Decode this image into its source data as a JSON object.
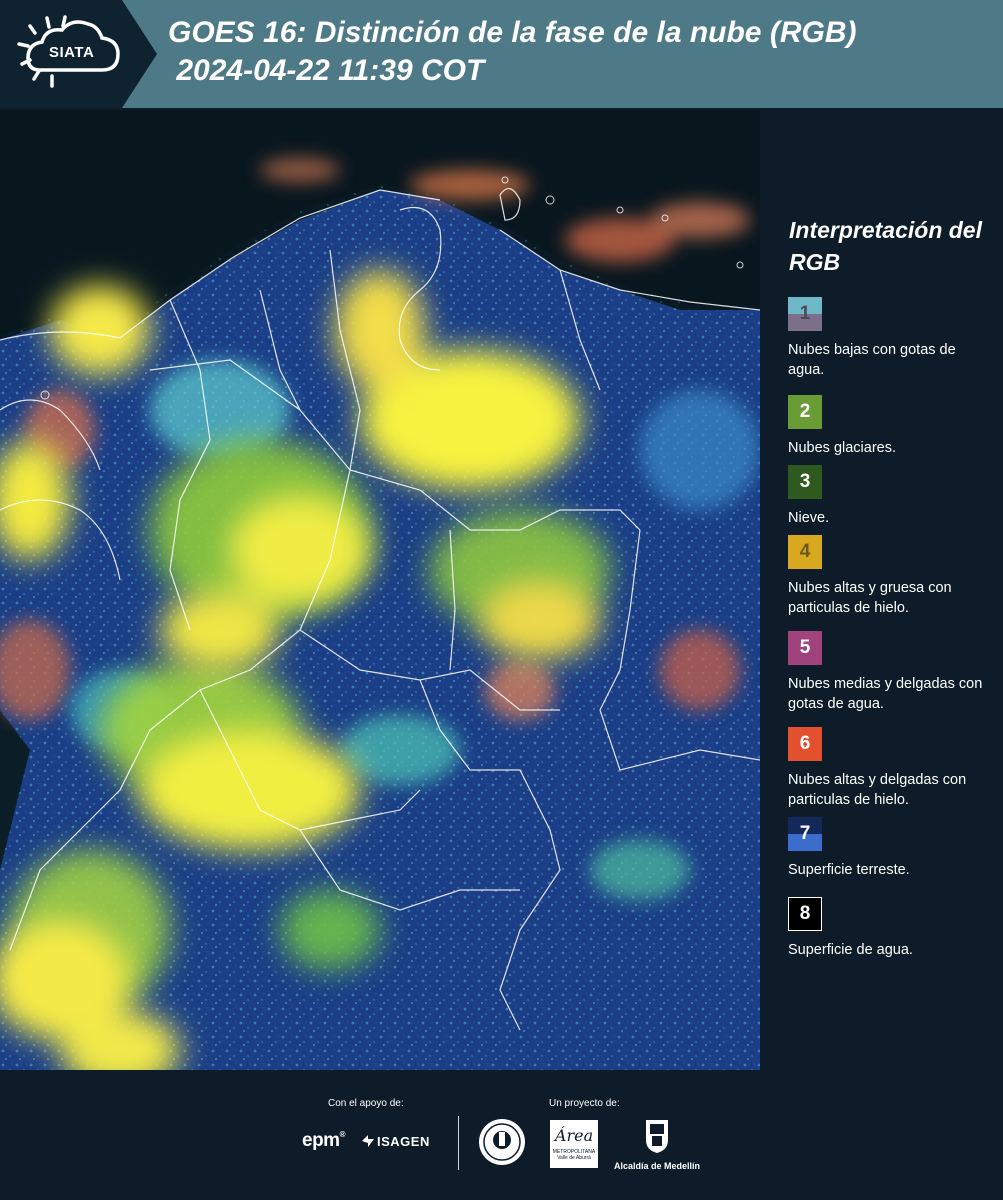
{
  "header": {
    "logo_text": "SIATA",
    "title_line1": "GOES 16: Distinción de la fase de la nube (RGB)",
    "title_line2": " 2024-04-22 11:39 COT"
  },
  "legend": {
    "title": "Interpretación del RGB",
    "items": [
      {
        "number": "1",
        "label": "Nubes bajas con gotas de agua.",
        "color_top": "#6fb8c7",
        "color_bottom": "#7b6f8a"
      },
      {
        "number": "2",
        "label": "Nubes glaciares.",
        "color_top": "#6a9c35",
        "color_bottom": "#6a9c35"
      },
      {
        "number": "3",
        "label": "Nieve.",
        "color_top": "#2f5a1f",
        "color_bottom": "#2f5a1f"
      },
      {
        "number": "4",
        "label": "Nubes altas y gruesa con particulas de hielo.",
        "color_top": "#d8a81e",
        "color_bottom": "#d8a81e"
      },
      {
        "number": "5",
        "label": "Nubes medias y delgadas con gotas de agua.",
        "color_top": "#a0437c",
        "color_bottom": "#a0437c"
      },
      {
        "number": "6",
        "label": "Nubes altas y delgadas con particulas de hielo.",
        "color_top": "#e2502e",
        "color_bottom": "#e2502e"
      },
      {
        "number": "7",
        "label": "Superficie terreste.",
        "color_top": "#14285a",
        "color_bottom": "#3c6ccc"
      },
      {
        "number": "8",
        "label": "Superficie de agua.",
        "color_top": "#000000",
        "color_bottom": "#000000"
      }
    ]
  },
  "footer": {
    "support_label": "Con el apoyo de:",
    "project_label": "Un proyecto de:",
    "sponsor_epm": "epm",
    "sponsor_isagen": "ISAGEN",
    "sponsor_area_script": "Área",
    "sponsor_area_line1": "METROPOLITANA",
    "sponsor_area_line2": "Valle de Aburrá",
    "sponsor_alcaldia": "Alcaldía de Medellín"
  },
  "colors": {
    "header_bg": "#4e7a88",
    "page_bg": "#0d1c28",
    "cloud_yellow": "#f2f03a",
    "cloud_green": "#9bd23a",
    "cloud_orange": "#e07a4a",
    "land_blue": "#1b3e86",
    "sea_dark": "#0a1a24"
  }
}
